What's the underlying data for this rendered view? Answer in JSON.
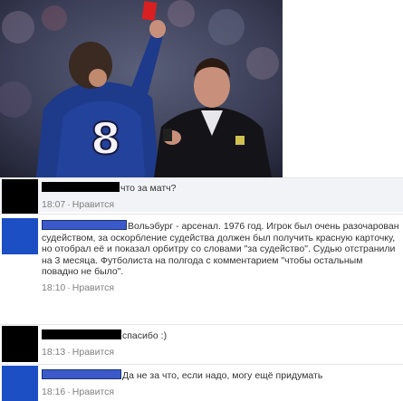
{
  "photo": {
    "jersey_number": "8"
  },
  "comments": [
    {
      "text": "что за матч?",
      "time": "18:07",
      "separator": "·",
      "like_label": "Нравится",
      "avatar_color": "#000000",
      "name_color": "#000000"
    },
    {
      "text": "Вольэбург - арсенал. 1976 год. Игрок был очень разочарован судейством, за оскорбление судейства должен был получить красную карточку, но отобрал её и показал орбитру со словами \"за судейство\". Судью отстранили на 3 месяца. Футболиста на полгода с комментарием \"чтобы остальным повадно не было\".",
      "time": "18:10",
      "separator": "·",
      "like_label": "Нравится",
      "avatar_color": "#1c4fc4",
      "name_color": "#3b59c8"
    },
    {
      "text": "спасибо :)",
      "time": "18:13",
      "separator": "·",
      "like_label": "Нравится",
      "avatar_color": "#000000",
      "name_color": "#000000"
    },
    {
      "text": "Да не за что, если надо, могу ещё придумать",
      "time": "18:16",
      "separator": "·",
      "like_label": "Нравится",
      "avatar_color": "#1c4fc4",
      "name_color": "#3b59c8"
    }
  ]
}
